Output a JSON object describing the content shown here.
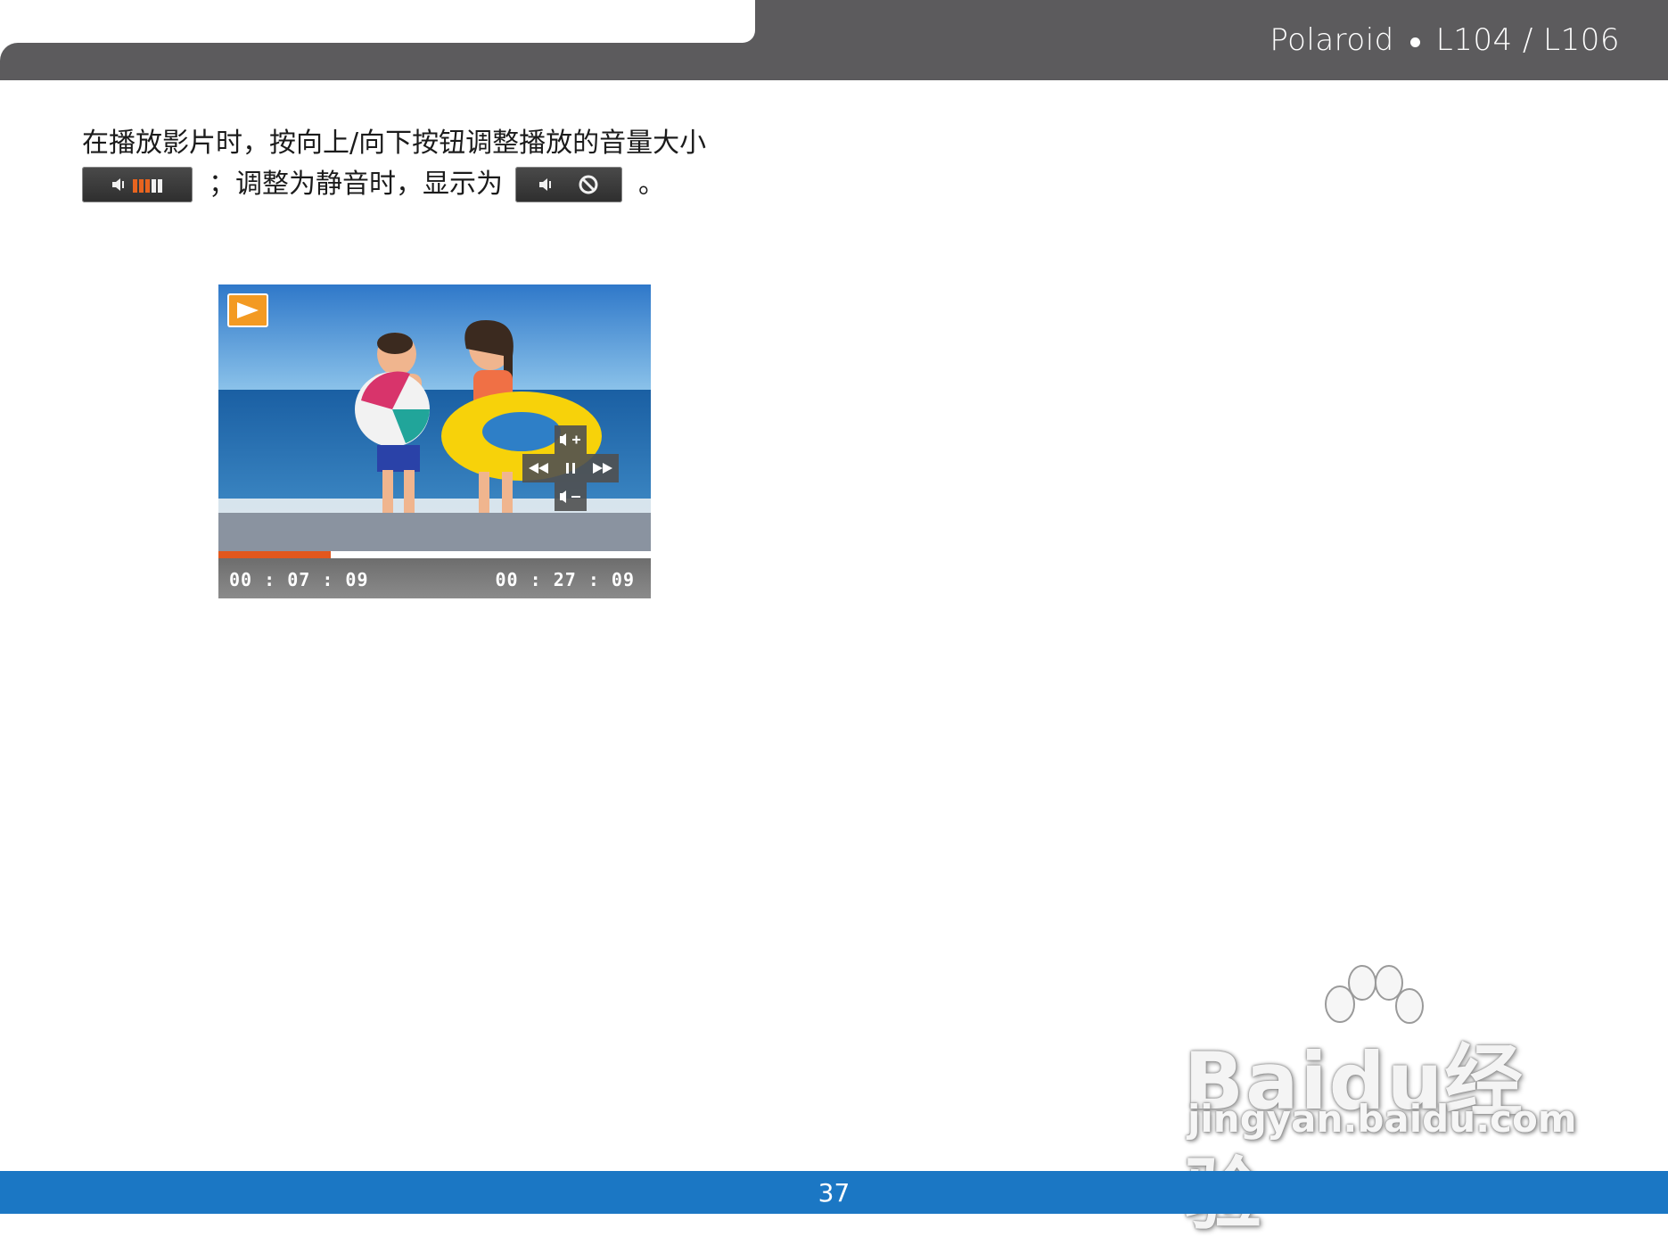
{
  "header": {
    "brand": "Polaroid",
    "model": "L104 / L106"
  },
  "body": {
    "line1": "在播放影片时，按向上/向下按钮调整播放的音量大小",
    "line2_part1": "；调整为静音时，显示为",
    "line2_end": "。"
  },
  "icons": {
    "volume_osd": "volume-level-osd-icon",
    "mute_osd": "mute-osd-icon",
    "play_badge": "play-mode-icon"
  },
  "player": {
    "current_time": "00 : 07 : 09",
    "total_time": "00 : 27 : 09",
    "progress": 0.26,
    "volume_bars_total": 5,
    "volume_bars_active": 3,
    "controls": [
      "volume-up",
      "rewind",
      "pause",
      "fast-forward",
      "volume-down"
    ]
  },
  "footer": {
    "page_number": "37"
  },
  "watermark": {
    "main": "Baidu经验",
    "sub": "jingyan.baidu.com"
  },
  "colors": {
    "header_gray": "#5c5b5d",
    "footer_blue": "#1b77c4",
    "accent_orange": "#e2571d"
  }
}
